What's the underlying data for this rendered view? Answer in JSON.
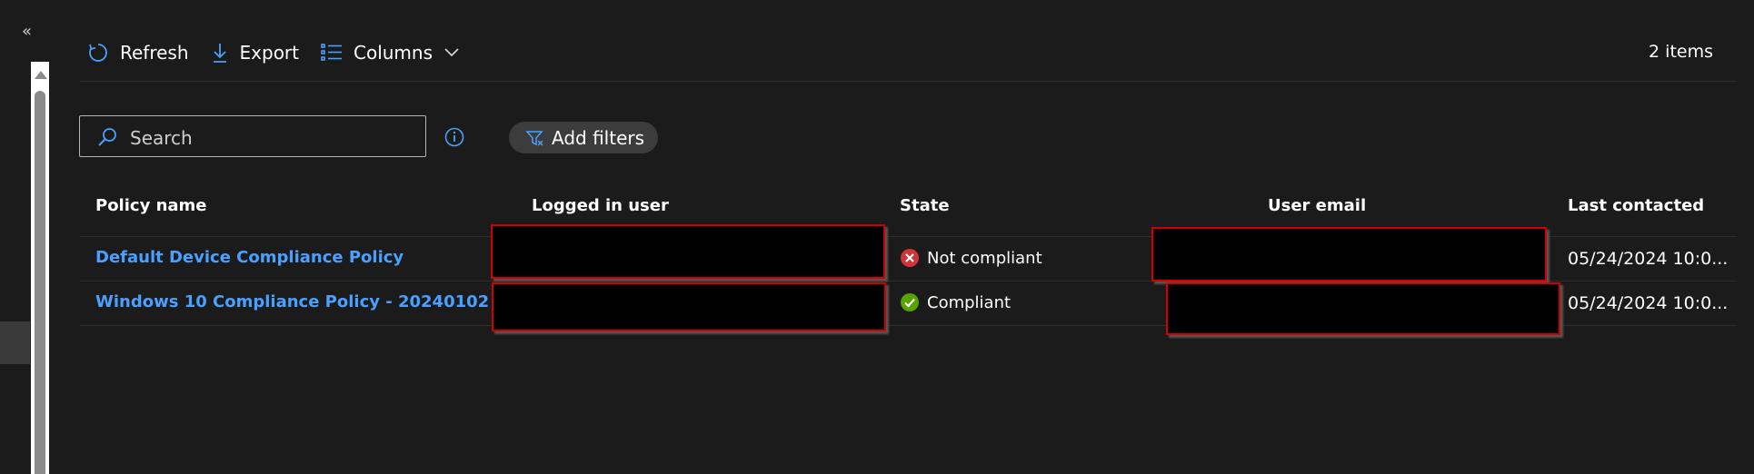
{
  "toolbar": {
    "refresh_label": "Refresh",
    "export_label": "Export",
    "columns_label": "Columns",
    "items_count": "2 items"
  },
  "filters": {
    "search_placeholder": "Search",
    "add_filters_label": "Add filters"
  },
  "table": {
    "headers": [
      "Policy name",
      "Logged in user",
      "State",
      "User email",
      "Last contacted"
    ],
    "rows": [
      {
        "policy_name": "Default Device Compliance Policy",
        "state": "Not compliant",
        "state_icon": "error-icon",
        "last_contacted": "05/24/2024 10:0..."
      },
      {
        "policy_name": "Windows 10 Compliance Policy - 20240102",
        "state": "Compliant",
        "state_icon": "success-icon",
        "last_contacted": "05/24/2024 10:0..."
      }
    ]
  },
  "colors": {
    "accent": "#4aa0ff",
    "background": "#1b1b1b",
    "error": "#d13438",
    "success": "#57a300",
    "redaction_border": "#d40000"
  }
}
